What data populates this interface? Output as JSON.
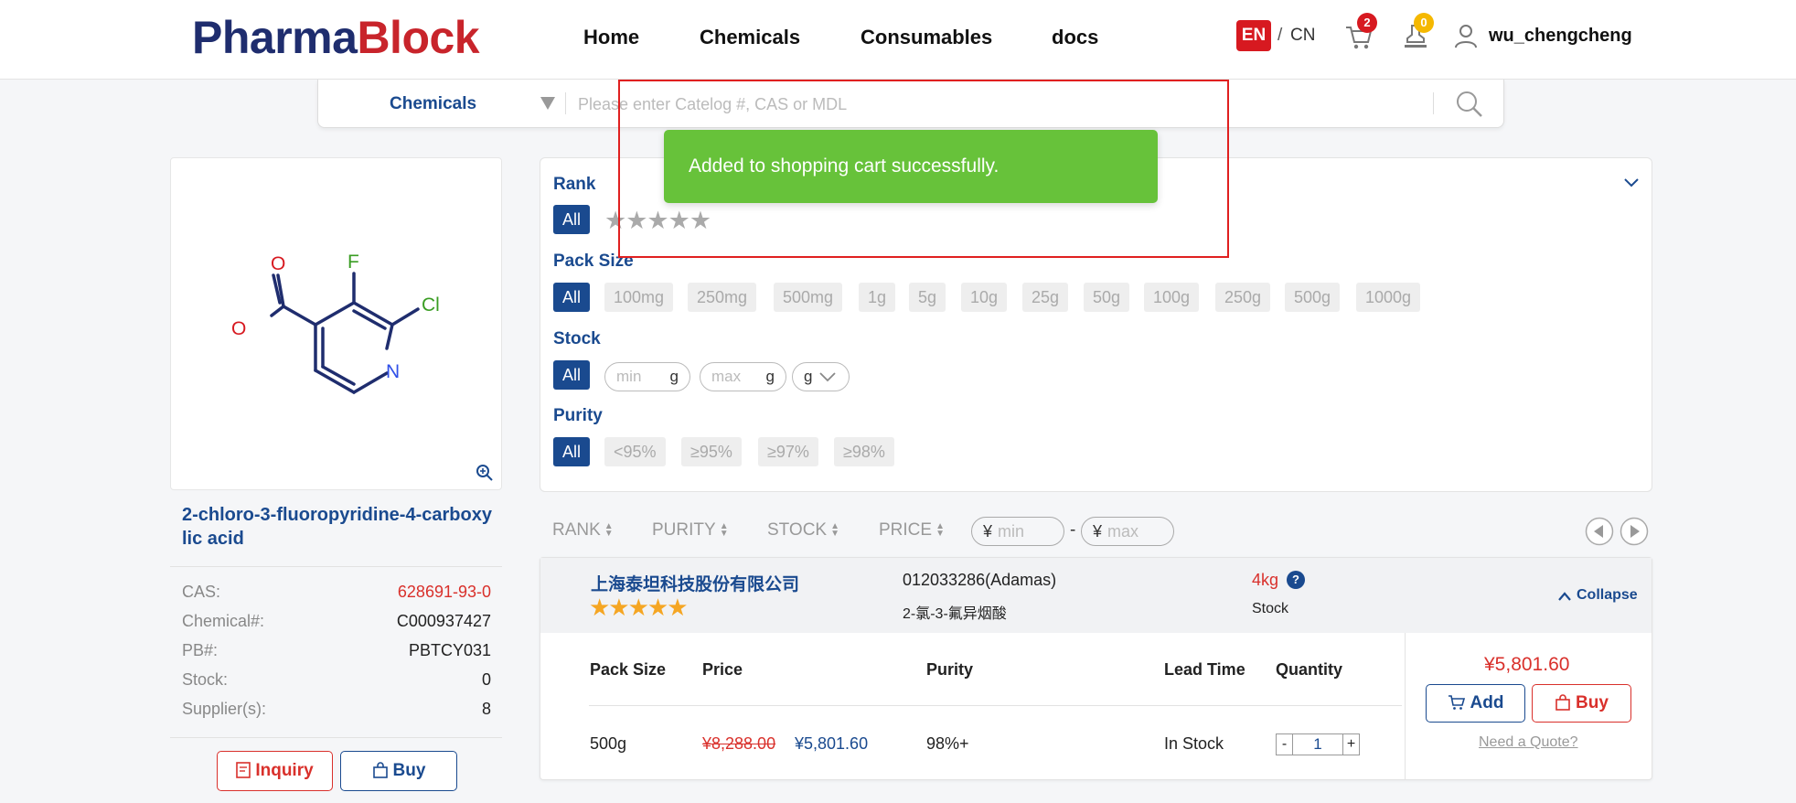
{
  "header": {
    "logo_part1": "Pharma",
    "logo_part2": "Block",
    "nav": [
      "Home",
      "Chemicals",
      "Consumables",
      "docs"
    ],
    "lang_active": "EN",
    "lang_sep": "/",
    "lang_other": "CN",
    "cart_count": "2",
    "quote_count": "0",
    "username": "wu_chengcheng"
  },
  "search": {
    "category": "Chemicals",
    "placeholder": "Please enter Catelog #, CAS or MDL"
  },
  "toast": {
    "message": "Added to shopping cart successfully."
  },
  "product": {
    "name": "2-chloro-3-fluoropyridine-4-carboxylic acid",
    "structure_atoms": [
      "O",
      "F",
      "O",
      "Cl",
      "N"
    ],
    "info": [
      {
        "label": "CAS:",
        "value": "628691-93-0"
      },
      {
        "label": "Chemical#:",
        "value": "C000937427"
      },
      {
        "label": "PB#:",
        "value": "PBTCY031"
      },
      {
        "label": "Stock:",
        "value": "0"
      },
      {
        "label": "Supplier(s):",
        "value": "8"
      }
    ],
    "inquiry_label": "Inquiry",
    "buy_label": "Buy",
    "colors": {
      "cas": "#d9302b",
      "brand_blue": "#1a4a8f",
      "brand_red": "#c8242b"
    }
  },
  "filters": {
    "rank_title": "Rank",
    "pack_title": "Pack Size",
    "stock_title": "Stock",
    "purity_title": "Purity",
    "all_label": "All",
    "pack_sizes": [
      "100mg",
      "250mg",
      "500mg",
      "1g",
      "5g",
      "10g",
      "25g",
      "50g",
      "100g",
      "250g",
      "500g",
      "1000g"
    ],
    "stock_min_placeholder": "min",
    "stock_max_placeholder": "max",
    "stock_unit": "g",
    "purities": [
      "<95%",
      "≥95%",
      "≥97%",
      "≥98%"
    ]
  },
  "sort": {
    "items": [
      "RANK",
      "PURITY",
      "STOCK",
      "PRICE"
    ],
    "currency": "¥",
    "price_min": "min",
    "price_max": "max",
    "dash": "-"
  },
  "supplier": {
    "name": "上海泰坦科技股份有限公司",
    "rating": 5,
    "catalog": "012033286(Adamas)",
    "cn_name": "2-氯-3-氟异烟酸",
    "stock_value": "4kg",
    "stock_label": "Stock",
    "collapse_label": "Collapse",
    "table_headers": [
      "Pack Size",
      "Price",
      "Purity",
      "Lead Time",
      "Quantity"
    ],
    "row": {
      "pack_size": "500g",
      "old_price": "¥8,288.00",
      "price": "¥5,801.60",
      "purity": "98%+",
      "lead_time": "In Stock",
      "qty_minus": "-",
      "quantity": "1",
      "qty_plus": "+"
    },
    "total_price": "¥5,801.60",
    "add_label": "Add",
    "buy_label": "Buy",
    "quote_label": "Need a Quote?"
  }
}
